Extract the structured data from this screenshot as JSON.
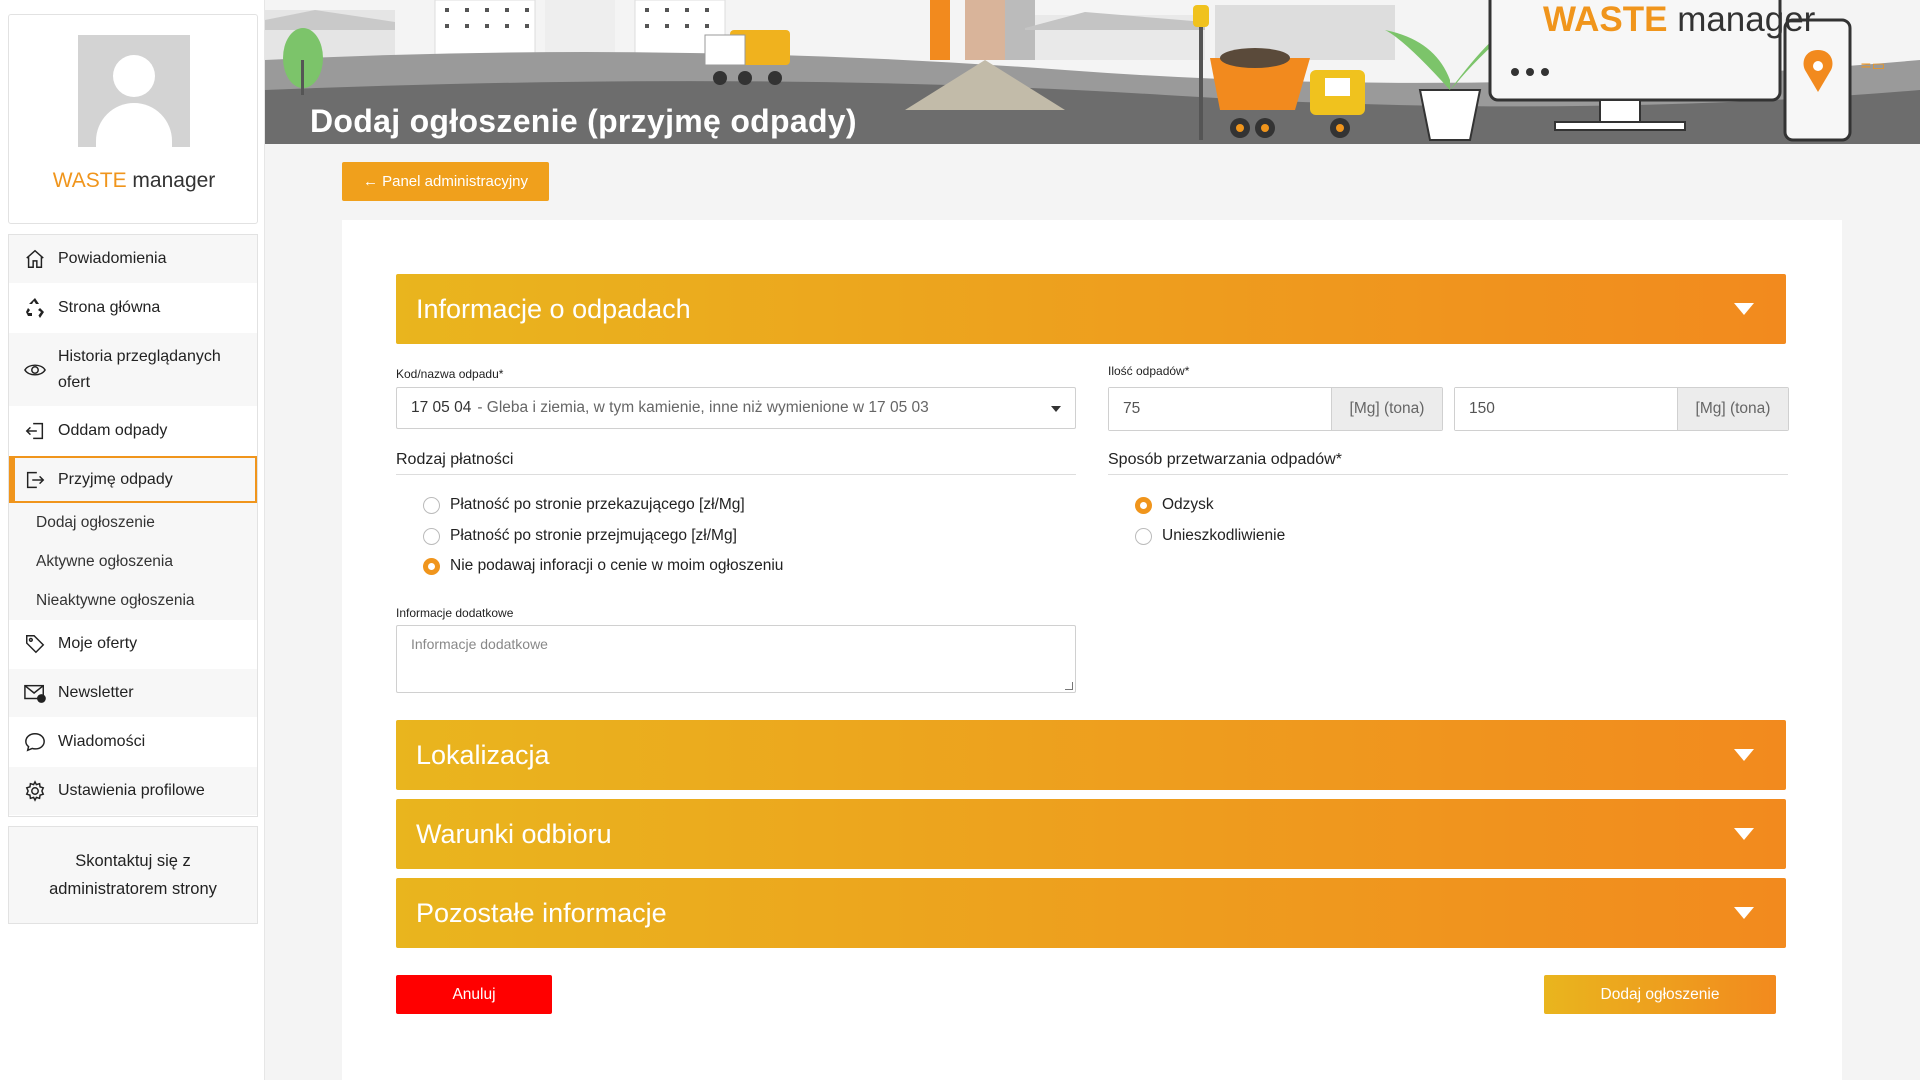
{
  "brand": {
    "waste": "WASTE",
    "manager": "manager"
  },
  "sidebar": {
    "items": [
      {
        "label": "Powiadomienia",
        "icon": "home-icon"
      },
      {
        "label": "Strona główna",
        "icon": "recycle-icon"
      },
      {
        "label": "Historia przeglądanych ofert",
        "icon": "eye-icon"
      },
      {
        "label": "Oddam odpady",
        "icon": "log-in-icon"
      },
      {
        "label": "Przyjmę odpady",
        "icon": "log-out-icon"
      },
      {
        "label": "Moje oferty",
        "icon": "tag-icon"
      },
      {
        "label": "Newsletter",
        "icon": "mail-icon"
      },
      {
        "label": "Wiadomości",
        "icon": "chat-icon"
      },
      {
        "label": "Ustawienia profilowe",
        "icon": "gear-icon"
      }
    ],
    "submenu": [
      "Dodaj ogłoszenie",
      "Aktywne ogłoszenia",
      "Nieaktywne ogłoszenia"
    ],
    "contact": "Skontaktuj się z administratorem strony"
  },
  "header": {
    "title": "Dodaj ogłoszenie (przyjmę odpady)"
  },
  "back_button": "← Panel administracyjny",
  "form": {
    "sections": [
      "Informacje o odpadach",
      "Lokalizacja",
      "Warunki odbioru",
      "Pozostałe informacje"
    ],
    "waste_code_label": "Kod/nazwa odpadu*",
    "waste_code": "17 05 04",
    "waste_name": "- Gleba i ziemia, w tym kamienie, inne niż wymienione w 17 05 03",
    "quantity_label": "Ilość odpadów*",
    "quantity_min": "75",
    "quantity_max": "150",
    "unit": "[Mg] (tona)",
    "payment_label": "Rodzaj płatności",
    "payment_options": [
      {
        "label": "Płatność po stronie przekazującego [zł/Mg]",
        "selected": false
      },
      {
        "label": "Płatność po stronie przejmującego [zł/Mg]",
        "selected": false
      },
      {
        "label": "Nie podawaj inforacji o cenie w moim ogłoszeniu",
        "selected": true
      }
    ],
    "processing_label": "Sposób przetwarzania odpadów*",
    "processing_options": [
      {
        "label": "Odzysk",
        "selected": true
      },
      {
        "label": "Unieszkodliwienie",
        "selected": false
      }
    ],
    "extra_label": "Informacje dodatkowe",
    "extra_placeholder": "Informacje dodatkowe",
    "cancel": "Anuluj",
    "submit": "Dodaj ogłoszenie"
  },
  "colors": {
    "accent": "#f0951c",
    "gradient_start": "#e9b51e",
    "gradient_end": "#f28a1e",
    "cancel": "#ff0000"
  }
}
